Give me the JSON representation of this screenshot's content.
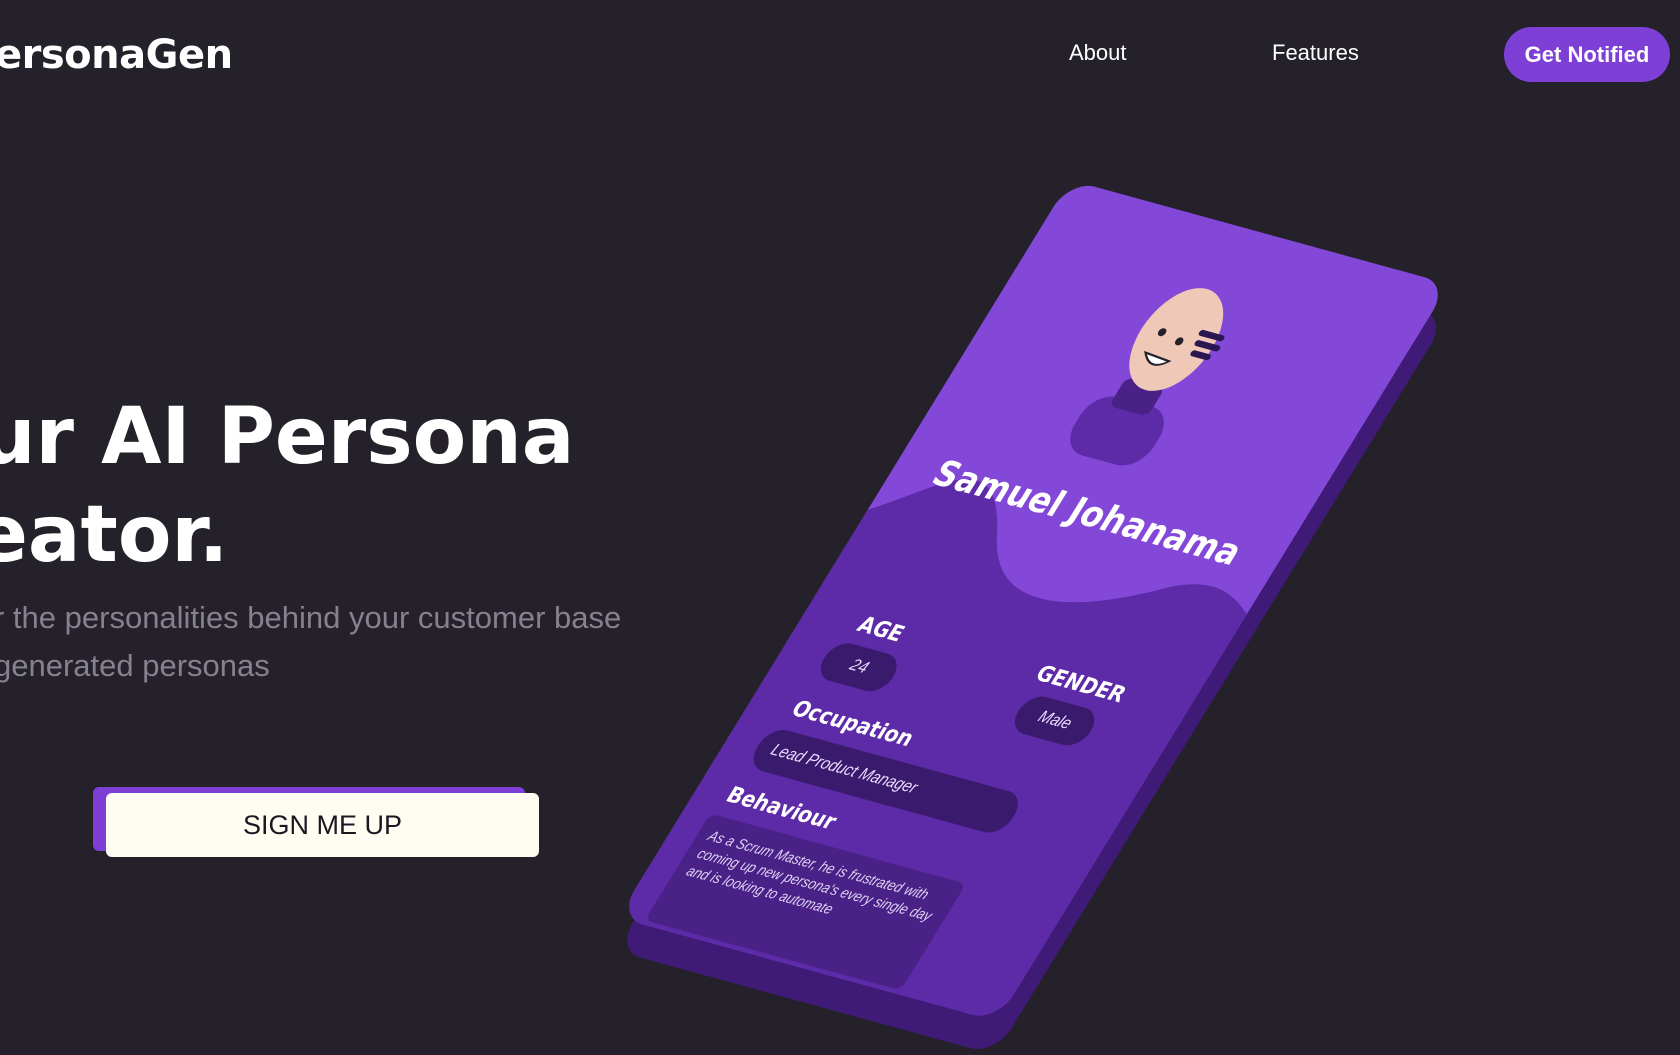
{
  "header": {
    "logo": "ersonaGen",
    "nav": [
      {
        "label": "About"
      },
      {
        "label": "Features"
      }
    ],
    "cta_label": "Get Notified"
  },
  "hero": {
    "title_lines": [
      "ur AI Persona",
      "eator."
    ],
    "subtitle_lines": [
      "r the personalities behind your customer base",
      " generated personas"
    ],
    "button_label": "SIGN ME UP"
  },
  "persona_card": {
    "name": "Samuel Johanama",
    "age_label": "AGE",
    "age_value": "24",
    "gender_label": "GENDER",
    "gender_value": "Male",
    "occupation_label": "Occupation",
    "occupation_value": "Lead Product Manager",
    "behaviour_label": "Behaviour",
    "behaviour_text": "As a Scrum Master, he is frustrated with coming up new persona's every single day and is looking to automate"
  },
  "colors": {
    "background": "#24212b",
    "accent": "#7e3fd6",
    "card": "#8448d8",
    "card_dark": "#3f1b77",
    "button_light": "#fffdf2",
    "subtitle": "#85818f"
  }
}
